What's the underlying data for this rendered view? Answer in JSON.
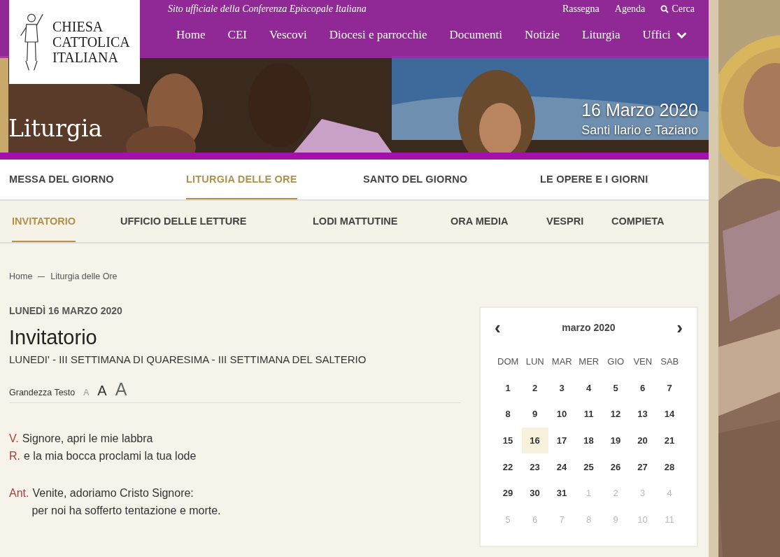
{
  "header": {
    "logo_text": "CHIESA CATTOLICA ITALIANA",
    "tagline": "Sito ufficiale della Conferenza Episcopale Italiana",
    "top_links": [
      {
        "label": "Rassegna",
        "kind": "link"
      },
      {
        "label": "Agenda",
        "kind": "link"
      },
      {
        "label": "Cerca",
        "kind": "search"
      }
    ],
    "nav": [
      {
        "label": "Home",
        "kind": "link"
      },
      {
        "label": "CEI",
        "kind": "link"
      },
      {
        "label": "Vescovi",
        "kind": "link"
      },
      {
        "label": "Diocesi e parrocchie",
        "kind": "link"
      },
      {
        "label": "Documenti",
        "kind": "link"
      },
      {
        "label": "Notizie",
        "kind": "link"
      },
      {
        "label": "Liturgia",
        "kind": "link"
      },
      {
        "label": "Uffici",
        "kind": "dropdown"
      }
    ],
    "hero": {
      "title": "Liturgia",
      "date": "16 Marzo 2020",
      "saints": "Santi Ilario e Taziano"
    }
  },
  "tabs": [
    {
      "label": "MESSA DEL GIORNO",
      "selected": false
    },
    {
      "label": "LITURGIA DELLE ORE",
      "selected": true
    },
    {
      "label": "SANTO DEL GIORNO",
      "selected": false
    },
    {
      "label": "LE OPERE E I GIORNI",
      "selected": false
    }
  ],
  "subtabs": [
    {
      "label": "INVITATORIO",
      "selected": true
    },
    {
      "label": "UFFICIO DELLE LETTURE",
      "selected": false
    },
    {
      "label": "LODI MATTUTINE",
      "selected": false
    },
    {
      "label": "ORA MEDIA",
      "selected": false
    },
    {
      "label": "VESPRI",
      "selected": false
    },
    {
      "label": "COMPIETA",
      "selected": false
    }
  ],
  "breadcrumb": [
    "Home",
    "Liturgia delle Ore"
  ],
  "date_heading": "LUNEDÌ 16 MARZO 2020",
  "title": "Invitatorio",
  "subtitle": "LUNEDI' - III SETTIMANA DI QUARESIMA - III SETTIMANA DEL SALTERIO",
  "text_size": {
    "label": "Grandezza Testo",
    "options": [
      {
        "label": "A",
        "selected": false
      },
      {
        "label": "A",
        "selected": false
      },
      {
        "label": "A",
        "selected": false
      }
    ]
  },
  "stanzas": [
    [
      {
        "marker": "V.",
        "lines": [
          "Signore, apri le mie labbra"
        ]
      },
      {
        "marker": "R.",
        "lines": [
          "e la mia bocca proclami la tua lode"
        ]
      }
    ],
    [
      {
        "marker": "Ant.",
        "lines": [
          "Venite, adoriamo Cristo Signore:",
          "per noi ha sofferto tentazione e morte."
        ]
      }
    ]
  ],
  "calendar": {
    "month": "marzo 2020",
    "prev": "‹",
    "next": "›",
    "weekdays": [
      "DOM",
      "LUN",
      "MAR",
      "MER",
      "GIO",
      "VEN",
      "SAB"
    ],
    "weeks": [
      [
        {
          "day": "1",
          "other_month": false,
          "selected": false
        },
        {
          "day": "2",
          "other_month": false,
          "selected": false
        },
        {
          "day": "3",
          "other_month": false,
          "selected": false
        },
        {
          "day": "4",
          "other_month": false,
          "selected": false
        },
        {
          "day": "5",
          "other_month": false,
          "selected": false
        },
        {
          "day": "6",
          "other_month": false,
          "selected": false
        },
        {
          "day": "7",
          "other_month": false,
          "selected": false
        }
      ],
      [
        {
          "day": "8",
          "other_month": false,
          "selected": false
        },
        {
          "day": "9",
          "other_month": false,
          "selected": false
        },
        {
          "day": "10",
          "other_month": false,
          "selected": false
        },
        {
          "day": "11",
          "other_month": false,
          "selected": false
        },
        {
          "day": "12",
          "other_month": false,
          "selected": false
        },
        {
          "day": "13",
          "other_month": false,
          "selected": false
        },
        {
          "day": "14",
          "other_month": false,
          "selected": false
        }
      ],
      [
        {
          "day": "15",
          "other_month": false,
          "selected": false
        },
        {
          "day": "16",
          "other_month": false,
          "selected": true
        },
        {
          "day": "17",
          "other_month": false,
          "selected": false
        },
        {
          "day": "18",
          "other_month": false,
          "selected": false
        },
        {
          "day": "19",
          "other_month": false,
          "selected": false
        },
        {
          "day": "20",
          "other_month": false,
          "selected": false
        },
        {
          "day": "21",
          "other_month": false,
          "selected": false
        }
      ],
      [
        {
          "day": "22",
          "other_month": false,
          "selected": false
        },
        {
          "day": "23",
          "other_month": false,
          "selected": false
        },
        {
          "day": "24",
          "other_month": false,
          "selected": false
        },
        {
          "day": "25",
          "other_month": false,
          "selected": false
        },
        {
          "day": "26",
          "other_month": false,
          "selected": false
        },
        {
          "day": "27",
          "other_month": false,
          "selected": false
        },
        {
          "day": "28",
          "other_month": false,
          "selected": false
        }
      ],
      [
        {
          "day": "29",
          "other_month": false,
          "selected": false
        },
        {
          "day": "30",
          "other_month": false,
          "selected": false
        },
        {
          "day": "31",
          "other_month": false,
          "selected": false
        },
        {
          "day": "1",
          "other_month": true,
          "selected": false
        },
        {
          "day": "2",
          "other_month": true,
          "selected": false
        },
        {
          "day": "3",
          "other_month": true,
          "selected": false
        },
        {
          "day": "4",
          "other_month": true,
          "selected": false
        }
      ],
      [
        {
          "day": "5",
          "other_month": true,
          "selected": false
        },
        {
          "day": "6",
          "other_month": true,
          "selected": false
        },
        {
          "day": "7",
          "other_month": true,
          "selected": false
        },
        {
          "day": "8",
          "other_month": true,
          "selected": false
        },
        {
          "day": "9",
          "other_month": true,
          "selected": false
        },
        {
          "day": "10",
          "other_month": true,
          "selected": false
        },
        {
          "day": "11",
          "other_month": true,
          "selected": false
        }
      ]
    ]
  }
}
